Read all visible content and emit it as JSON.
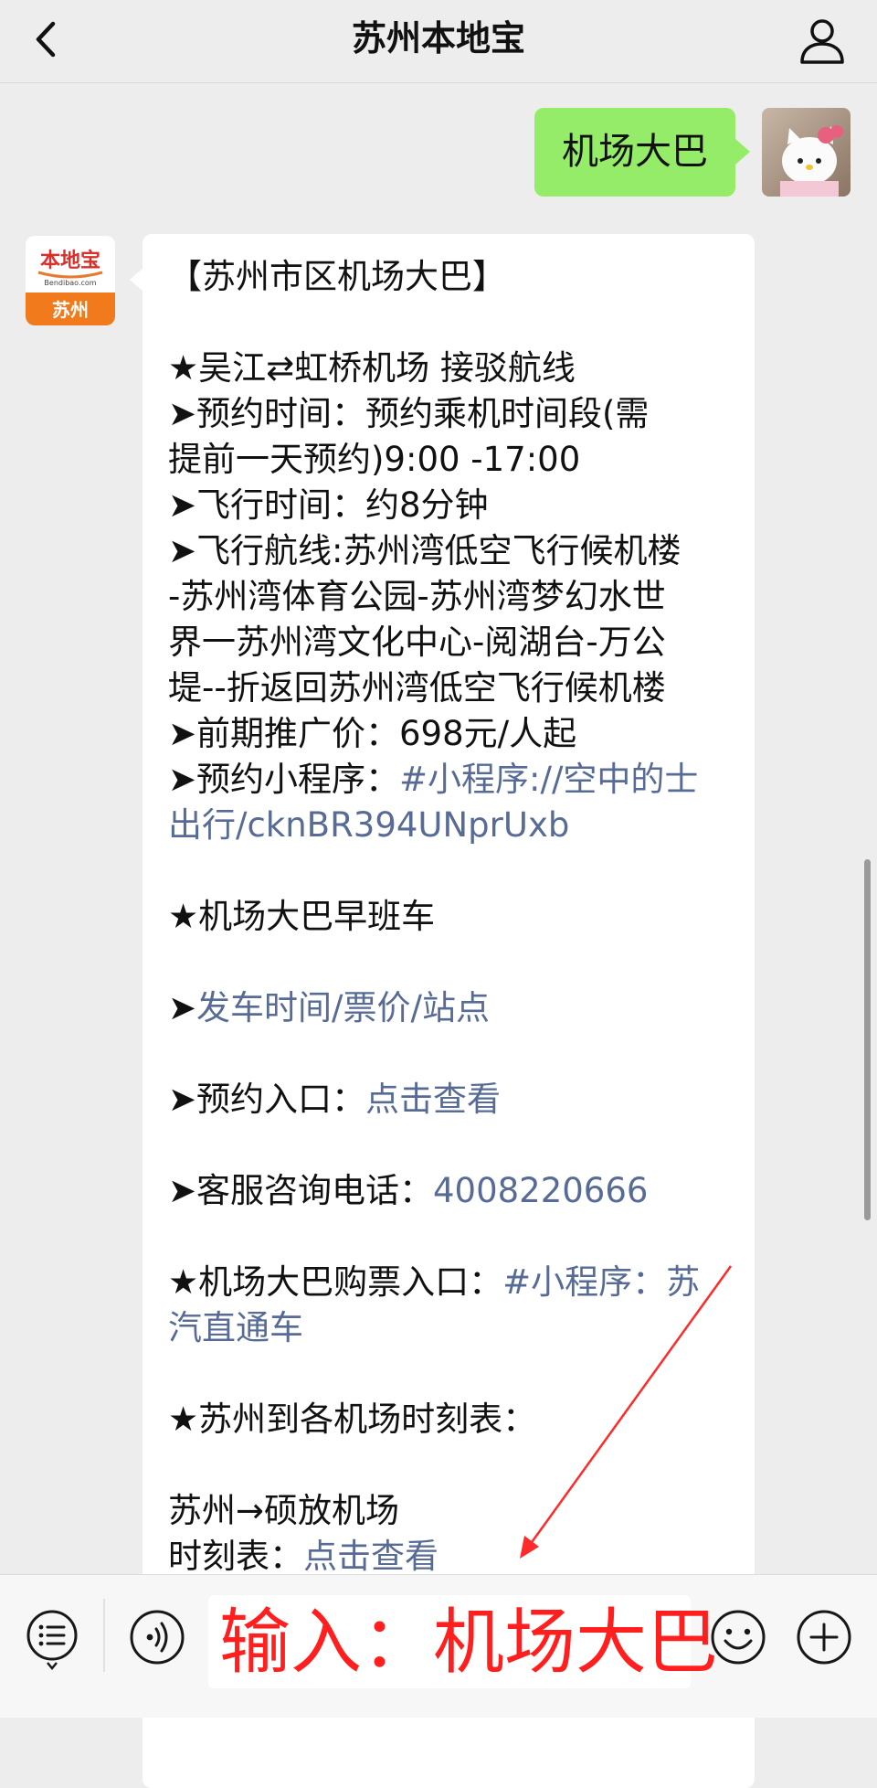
{
  "header": {
    "title": "苏州本地宝",
    "back_icon": "chevron-left-icon",
    "profile_icon": "person-icon"
  },
  "chat": {
    "outgoing": {
      "text": "机场大巴"
    },
    "bot_avatar": {
      "brand": "本地宝",
      "domain": "Bendibao.com",
      "city": "苏州"
    },
    "incoming": {
      "lines": [
        [
          {
            "t": "【苏州市区机场大巴】"
          }
        ],
        [],
        [
          {
            "t": "★吴江⇄虹桥机场 接驳航线"
          }
        ],
        [
          {
            "t": "➤预约时间：预约乘机时间段(需"
          }
        ],
        [
          {
            "t": "提前一天预约)9:00 -17:00"
          }
        ],
        [
          {
            "t": "➤飞行时间：约8分钟"
          }
        ],
        [
          {
            "t": "➤飞行航线:苏州湾低空飞行候机楼"
          }
        ],
        [
          {
            "t": "-苏州湾体育公园-苏州湾梦幻水世"
          }
        ],
        [
          {
            "t": "界一苏州湾文化中心-阅湖台-万公"
          }
        ],
        [
          {
            "t": "堤--折返回苏州湾低空飞行候机楼"
          }
        ],
        [
          {
            "t": "➤前期推广价：698元/人起"
          }
        ],
        [
          {
            "t": "➤预约小程序："
          },
          {
            "t": "#小程序://空中的士",
            "link": true
          }
        ],
        [
          {
            "t": "出行/cknBR394UNprUxb",
            "link": true
          }
        ],
        [],
        [
          {
            "t": "★机场大巴早班车"
          }
        ],
        [],
        [
          {
            "t": "➤"
          },
          {
            "t": "发车时间/票价/站点",
            "link": true
          }
        ],
        [],
        [
          {
            "t": "➤预约入口："
          },
          {
            "t": "点击查看",
            "link": true
          }
        ],
        [],
        [
          {
            "t": "➤客服咨询电话："
          },
          {
            "t": "4008220666",
            "link": true
          }
        ],
        [],
        [
          {
            "t": "★机场大巴购票入口："
          },
          {
            "t": "#小程序：苏",
            "link": true
          }
        ],
        [
          {
            "t": "汽直通车",
            "link": true
          }
        ],
        [],
        [
          {
            "t": "★苏州到各机场时刻表："
          }
        ],
        [],
        [
          {
            "t": "苏州→硕放机场"
          }
        ],
        [
          {
            "t": "时刻表："
          },
          {
            "t": "点击查看",
            "link": true
          }
        ]
      ]
    }
  },
  "input_bar": {
    "menu_icon": "list-menu-icon",
    "voice_icon": "voice-icon",
    "input_text": "输入：机场大巴",
    "emoji_icon": "emoji-icon",
    "plus_icon": "plus-icon"
  },
  "colors": {
    "outgoing_bubble": "#95ec69",
    "link": "#576b95",
    "annotation": "#ff1f1f",
    "background": "#ededed"
  }
}
